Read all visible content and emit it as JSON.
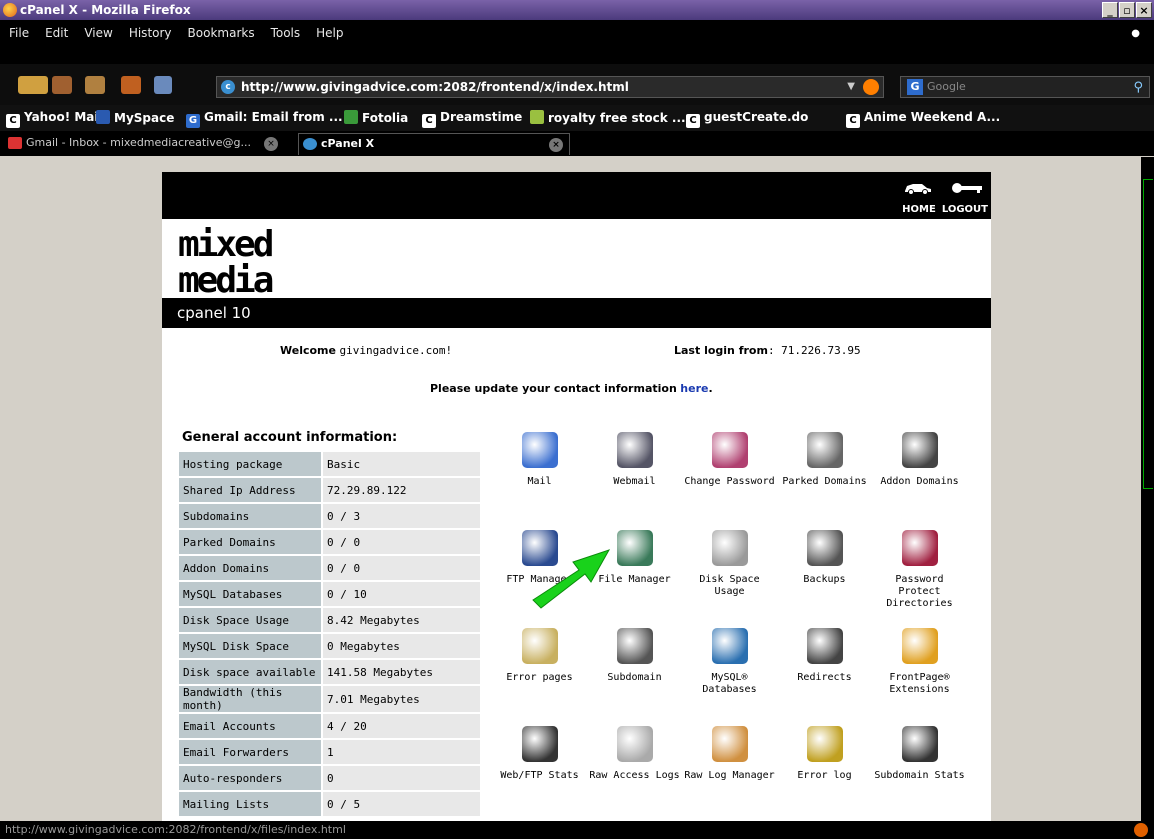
{
  "window": {
    "title": "cPanel X - Mozilla Firefox"
  },
  "menu": [
    "File",
    "Edit",
    "View",
    "History",
    "Bookmarks",
    "Tools",
    "Help"
  ],
  "nav": {
    "url": "http://www.givingadvice.com:2082/frontend/x/index.html",
    "search_placeholder": "Google"
  },
  "bookmarks": [
    "Yahoo! Mail",
    "MySpace",
    "Gmail: Email from ...",
    "Fotolia",
    "Dreamstime",
    "royalty free stock ...",
    "guestCreate.do",
    "Anime Weekend A..."
  ],
  "tabs": [
    {
      "label": "Gmail - Inbox - mixedmediacreative@g..."
    },
    {
      "label": "cPanel X"
    }
  ],
  "status": {
    "text": "http://www.givingadvice.com:2082/frontend/x/files/index.html"
  },
  "page": {
    "header_links": {
      "home": "HOME",
      "logout": "LOGOUT"
    },
    "logo_text": "mixed media",
    "cpanel_title": "cpanel 10",
    "welcome_label": "Welcome",
    "welcome_domain": "givingadvice.com!",
    "last_login_label": "Last login from",
    "last_login_ip": ": 71.226.73.95",
    "update_msg": "Please update your contact information",
    "update_link": "here",
    "update_end": ".",
    "info_title": "General account information:",
    "info_rows": [
      {
        "k": "Hosting package",
        "v": "Basic"
      },
      {
        "k": "Shared Ip Address",
        "v": "72.29.89.122"
      },
      {
        "k": "Subdomains",
        "v": "0 / 3"
      },
      {
        "k": "Parked Domains",
        "v": "0 / 0"
      },
      {
        "k": "Addon Domains",
        "v": "0 / 0"
      },
      {
        "k": "MySQL Databases",
        "v": "0 / 10"
      },
      {
        "k": "Disk Space Usage",
        "v": "8.42 Megabytes"
      },
      {
        "k": "MySQL Disk Space",
        "v": "0 Megabytes"
      },
      {
        "k": "Disk space available",
        "v": "141.58 Megabytes"
      },
      {
        "k": "Bandwidth (this month)",
        "v": "7.01 Megabytes"
      },
      {
        "k": "Email Accounts",
        "v": "4 / 20"
      },
      {
        "k": "Email Forwarders",
        "v": "1"
      },
      {
        "k": "Auto-responders",
        "v": "0"
      },
      {
        "k": "Mailing Lists",
        "v": "0 / 5"
      }
    ],
    "icons": [
      {
        "label": "Mail",
        "icon": "mail-icon",
        "color": "#3b6fd0"
      },
      {
        "label": "Webmail",
        "icon": "webmail-icon",
        "color": "#556"
      },
      {
        "label": "Change Password",
        "icon": "change-password-icon",
        "color": "#b04070"
      },
      {
        "label": "Parked Domains",
        "icon": "parked-domains-icon",
        "color": "#666"
      },
      {
        "label": "Addon Domains",
        "icon": "addon-domains-icon",
        "color": "#444"
      },
      {
        "label": "FTP Manager",
        "icon": "ftp-manager-icon",
        "color": "#2a4a90"
      },
      {
        "label": "File Manager",
        "icon": "file-manager-icon",
        "color": "#3a7a5a"
      },
      {
        "label": "Disk Space Usage",
        "icon": "disk-space-icon",
        "color": "#9a9a9a"
      },
      {
        "label": "Backups",
        "icon": "backups-icon",
        "color": "#555"
      },
      {
        "label": "Password Protect Directories",
        "icon": "password-protect-icon",
        "color": "#a02040"
      },
      {
        "label": "Error pages",
        "icon": "error-pages-icon",
        "color": "#c8b060"
      },
      {
        "label": "Subdomain",
        "icon": "subdomain-icon",
        "color": "#555"
      },
      {
        "label": "MySQL® Databases",
        "icon": "mysql-icon",
        "color": "#2a6fb0"
      },
      {
        "label": "Redirects",
        "icon": "redirects-icon",
        "color": "#444"
      },
      {
        "label": "FrontPage® Extensions",
        "icon": "frontpage-icon",
        "color": "#e0a020"
      },
      {
        "label": "Web/FTP Stats",
        "icon": "web-ftp-stats-icon",
        "color": "#333"
      },
      {
        "label": "Raw Access Logs",
        "icon": "raw-access-logs-icon",
        "color": "#aaa"
      },
      {
        "label": "Raw Log Manager",
        "icon": "raw-log-manager-icon",
        "color": "#d09040"
      },
      {
        "label": "Error log",
        "icon": "error-log-icon",
        "color": "#c0a020"
      },
      {
        "label": "Subdomain Stats",
        "icon": "subdomain-stats-icon",
        "color": "#333"
      }
    ]
  }
}
